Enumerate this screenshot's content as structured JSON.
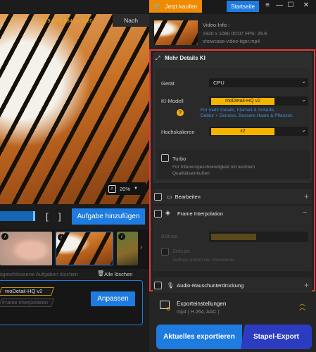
{
  "window": {
    "buy_label": "Jetzt kaufen",
    "home_label": "Startseite",
    "cart_icon": "cart-icon",
    "menu_icon": "menu-icon",
    "minimize_icon": "minimize-icon",
    "maximize_icon": "maximize-icon",
    "close_icon": "close-icon"
  },
  "preview": {
    "fps_text": "29.9 FPS  3840 x 2160",
    "after_label": "Nach",
    "zoom_value": "20%",
    "add_job_label": "Aufgabe hinzufügen",
    "bracket_open": "[",
    "bracket_close": "]"
  },
  "queue": {
    "discard_text": "Abgeschlossene Aufgaben löschen",
    "clear_all_label": "Alle löschen",
    "job_model": "moDetail-HQ  v2",
    "job_fi": "Frame Interpolation",
    "adjust_label": "Anpassen"
  },
  "video_info": {
    "title": "Video-Info :",
    "line1": "1920 x 1080   00:07   FPS: 29.9",
    "line2": "showcase-video-tiger.mp4"
  },
  "ai": {
    "title": "Mehr Details KI",
    "device_label": "Gerät",
    "device_value": "CPU",
    "model_label": "KI-Modell",
    "model_value": "moDetail-HQ  v2",
    "hint": "Für mehr Details, Klarheit & Schärfe.",
    "hint2": "Deblur + Denoise, Bessere Haare & Pflanzen.",
    "upscale_label": "Hochskalieren",
    "upscale_value": "x2",
    "turbo_label": "Turbo",
    "turbo_desc1": "Für Inferenzgeschwindigkeit mit leichtem",
    "turbo_desc2": "Qualitätseinbußen"
  },
  "sections": {
    "edit_label": "Bearbeiten",
    "fi_label": "Frame Interpolation",
    "fi_ratio_label": "Bildrate",
    "fi_slowmo_label": "Zeitlupe",
    "fi_slowmo_desc": "Zeitlupe ändert die Videodauer",
    "audio_label": "Audio-Rauschunterdrückung"
  },
  "export": {
    "title": "Exporteinstellungen",
    "format": "mp4 ( H.264, AAC )",
    "export_current": "Aktuelles exportieren",
    "export_batch": "Stapel-Export"
  },
  "colors": {
    "accent_blue": "#1e7be0",
    "buy_orange": "#f08a00",
    "highlight_yellow": "#f5b400",
    "panel_border_red": "#e23a3a"
  }
}
